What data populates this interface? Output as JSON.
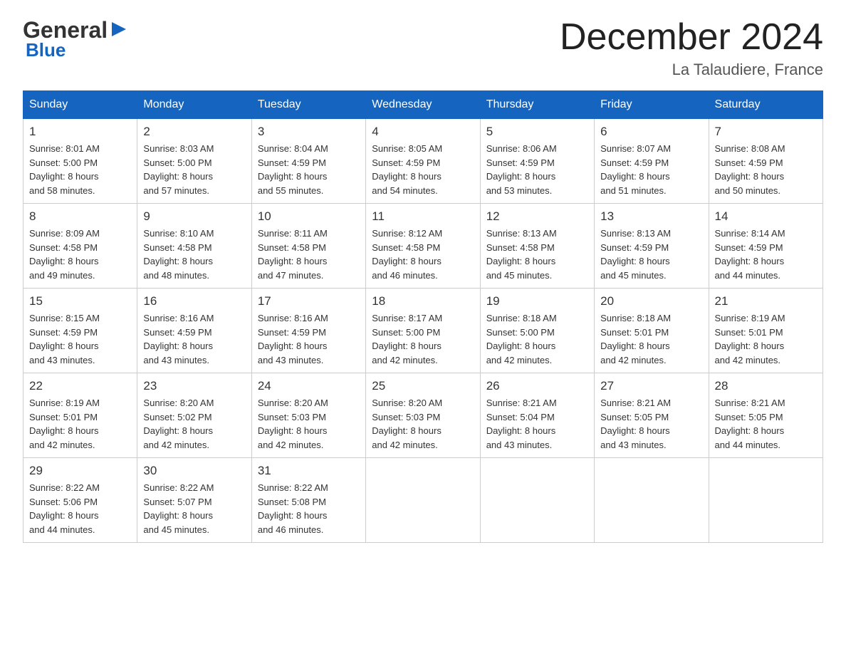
{
  "header": {
    "logo_general": "General",
    "logo_blue": "Blue",
    "month_title": "December 2024",
    "location": "La Talaudiere, France"
  },
  "days_of_week": [
    "Sunday",
    "Monday",
    "Tuesday",
    "Wednesday",
    "Thursday",
    "Friday",
    "Saturday"
  ],
  "weeks": [
    [
      {
        "day": "1",
        "sunrise": "Sunrise: 8:01 AM",
        "sunset": "Sunset: 5:00 PM",
        "daylight": "Daylight: 8 hours",
        "minutes": "and 58 minutes."
      },
      {
        "day": "2",
        "sunrise": "Sunrise: 8:03 AM",
        "sunset": "Sunset: 5:00 PM",
        "daylight": "Daylight: 8 hours",
        "minutes": "and 57 minutes."
      },
      {
        "day": "3",
        "sunrise": "Sunrise: 8:04 AM",
        "sunset": "Sunset: 4:59 PM",
        "daylight": "Daylight: 8 hours",
        "minutes": "and 55 minutes."
      },
      {
        "day": "4",
        "sunrise": "Sunrise: 8:05 AM",
        "sunset": "Sunset: 4:59 PM",
        "daylight": "Daylight: 8 hours",
        "minutes": "and 54 minutes."
      },
      {
        "day": "5",
        "sunrise": "Sunrise: 8:06 AM",
        "sunset": "Sunset: 4:59 PM",
        "daylight": "Daylight: 8 hours",
        "minutes": "and 53 minutes."
      },
      {
        "day": "6",
        "sunrise": "Sunrise: 8:07 AM",
        "sunset": "Sunset: 4:59 PM",
        "daylight": "Daylight: 8 hours",
        "minutes": "and 51 minutes."
      },
      {
        "day": "7",
        "sunrise": "Sunrise: 8:08 AM",
        "sunset": "Sunset: 4:59 PM",
        "daylight": "Daylight: 8 hours",
        "minutes": "and 50 minutes."
      }
    ],
    [
      {
        "day": "8",
        "sunrise": "Sunrise: 8:09 AM",
        "sunset": "Sunset: 4:58 PM",
        "daylight": "Daylight: 8 hours",
        "minutes": "and 49 minutes."
      },
      {
        "day": "9",
        "sunrise": "Sunrise: 8:10 AM",
        "sunset": "Sunset: 4:58 PM",
        "daylight": "Daylight: 8 hours",
        "minutes": "and 48 minutes."
      },
      {
        "day": "10",
        "sunrise": "Sunrise: 8:11 AM",
        "sunset": "Sunset: 4:58 PM",
        "daylight": "Daylight: 8 hours",
        "minutes": "and 47 minutes."
      },
      {
        "day": "11",
        "sunrise": "Sunrise: 8:12 AM",
        "sunset": "Sunset: 4:58 PM",
        "daylight": "Daylight: 8 hours",
        "minutes": "and 46 minutes."
      },
      {
        "day": "12",
        "sunrise": "Sunrise: 8:13 AM",
        "sunset": "Sunset: 4:58 PM",
        "daylight": "Daylight: 8 hours",
        "minutes": "and 45 minutes."
      },
      {
        "day": "13",
        "sunrise": "Sunrise: 8:13 AM",
        "sunset": "Sunset: 4:59 PM",
        "daylight": "Daylight: 8 hours",
        "minutes": "and 45 minutes."
      },
      {
        "day": "14",
        "sunrise": "Sunrise: 8:14 AM",
        "sunset": "Sunset: 4:59 PM",
        "daylight": "Daylight: 8 hours",
        "minutes": "and 44 minutes."
      }
    ],
    [
      {
        "day": "15",
        "sunrise": "Sunrise: 8:15 AM",
        "sunset": "Sunset: 4:59 PM",
        "daylight": "Daylight: 8 hours",
        "minutes": "and 43 minutes."
      },
      {
        "day": "16",
        "sunrise": "Sunrise: 8:16 AM",
        "sunset": "Sunset: 4:59 PM",
        "daylight": "Daylight: 8 hours",
        "minutes": "and 43 minutes."
      },
      {
        "day": "17",
        "sunrise": "Sunrise: 8:16 AM",
        "sunset": "Sunset: 4:59 PM",
        "daylight": "Daylight: 8 hours",
        "minutes": "and 43 minutes."
      },
      {
        "day": "18",
        "sunrise": "Sunrise: 8:17 AM",
        "sunset": "Sunset: 5:00 PM",
        "daylight": "Daylight: 8 hours",
        "minutes": "and 42 minutes."
      },
      {
        "day": "19",
        "sunrise": "Sunrise: 8:18 AM",
        "sunset": "Sunset: 5:00 PM",
        "daylight": "Daylight: 8 hours",
        "minutes": "and 42 minutes."
      },
      {
        "day": "20",
        "sunrise": "Sunrise: 8:18 AM",
        "sunset": "Sunset: 5:01 PM",
        "daylight": "Daylight: 8 hours",
        "minutes": "and 42 minutes."
      },
      {
        "day": "21",
        "sunrise": "Sunrise: 8:19 AM",
        "sunset": "Sunset: 5:01 PM",
        "daylight": "Daylight: 8 hours",
        "minutes": "and 42 minutes."
      }
    ],
    [
      {
        "day": "22",
        "sunrise": "Sunrise: 8:19 AM",
        "sunset": "Sunset: 5:01 PM",
        "daylight": "Daylight: 8 hours",
        "minutes": "and 42 minutes."
      },
      {
        "day": "23",
        "sunrise": "Sunrise: 8:20 AM",
        "sunset": "Sunset: 5:02 PM",
        "daylight": "Daylight: 8 hours",
        "minutes": "and 42 minutes."
      },
      {
        "day": "24",
        "sunrise": "Sunrise: 8:20 AM",
        "sunset": "Sunset: 5:03 PM",
        "daylight": "Daylight: 8 hours",
        "minutes": "and 42 minutes."
      },
      {
        "day": "25",
        "sunrise": "Sunrise: 8:20 AM",
        "sunset": "Sunset: 5:03 PM",
        "daylight": "Daylight: 8 hours",
        "minutes": "and 42 minutes."
      },
      {
        "day": "26",
        "sunrise": "Sunrise: 8:21 AM",
        "sunset": "Sunset: 5:04 PM",
        "daylight": "Daylight: 8 hours",
        "minutes": "and 43 minutes."
      },
      {
        "day": "27",
        "sunrise": "Sunrise: 8:21 AM",
        "sunset": "Sunset: 5:05 PM",
        "daylight": "Daylight: 8 hours",
        "minutes": "and 43 minutes."
      },
      {
        "day": "28",
        "sunrise": "Sunrise: 8:21 AM",
        "sunset": "Sunset: 5:05 PM",
        "daylight": "Daylight: 8 hours",
        "minutes": "and 44 minutes."
      }
    ],
    [
      {
        "day": "29",
        "sunrise": "Sunrise: 8:22 AM",
        "sunset": "Sunset: 5:06 PM",
        "daylight": "Daylight: 8 hours",
        "minutes": "and 44 minutes."
      },
      {
        "day": "30",
        "sunrise": "Sunrise: 8:22 AM",
        "sunset": "Sunset: 5:07 PM",
        "daylight": "Daylight: 8 hours",
        "minutes": "and 45 minutes."
      },
      {
        "day": "31",
        "sunrise": "Sunrise: 8:22 AM",
        "sunset": "Sunset: 5:08 PM",
        "daylight": "Daylight: 8 hours",
        "minutes": "and 46 minutes."
      },
      null,
      null,
      null,
      null
    ]
  ]
}
